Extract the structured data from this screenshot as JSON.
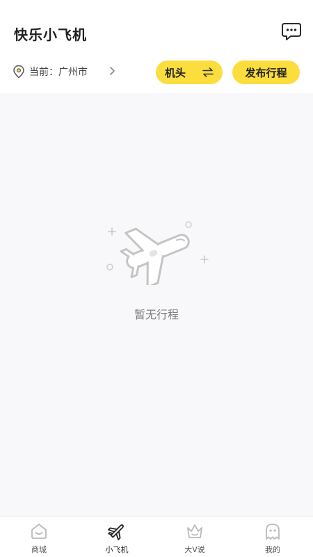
{
  "app": {
    "title": "快乐小飞机"
  },
  "location": {
    "text": "当前：广州市"
  },
  "buttons": {
    "switch_label": "机头",
    "publish_label": "发布行程"
  },
  "empty": {
    "text": "暂无行程"
  },
  "tabbar": {
    "items": [
      {
        "label": "商城",
        "icon": "shop-icon",
        "active": false
      },
      {
        "label": "小飞机",
        "icon": "airplane-icon",
        "active": true
      },
      {
        "label": "大V说",
        "icon": "crown-icon",
        "active": false
      },
      {
        "label": "我的",
        "icon": "ghost-icon",
        "active": false
      }
    ]
  },
  "colors": {
    "accent": "#fbdd3d",
    "background": "#f8f7fa",
    "icon_gray": "#bdbdbd"
  }
}
